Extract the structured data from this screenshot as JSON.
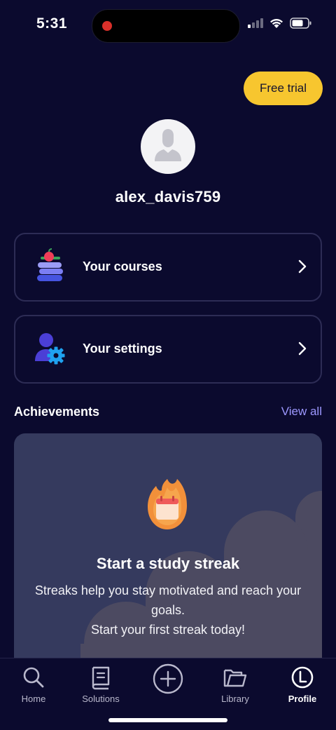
{
  "status_bar": {
    "time": "5:31"
  },
  "header": {
    "free_trial_label": "Free trial"
  },
  "profile": {
    "username": "alex_davis759"
  },
  "menu": {
    "courses_label": "Your courses",
    "settings_label": "Your settings"
  },
  "achievements": {
    "title": "Achievements",
    "view_all": "View all",
    "card_title": "Start a study streak",
    "card_desc_1": "Streaks help you stay motivated and reach your goals.",
    "card_desc_2": "Start your first streak today!"
  },
  "tabs": [
    {
      "label": "Home",
      "icon": "search-icon"
    },
    {
      "label": "Solutions",
      "icon": "book-icon"
    },
    {
      "label": "",
      "icon": "add-icon"
    },
    {
      "label": "Library",
      "icon": "folder-icon"
    },
    {
      "label": "Profile",
      "icon": "profile-icon"
    }
  ],
  "colors": {
    "background": "#0b0a2e",
    "accent_yellow": "#f7c62f",
    "link_purple": "#9d98ff",
    "card_bg": "#353a5e"
  }
}
